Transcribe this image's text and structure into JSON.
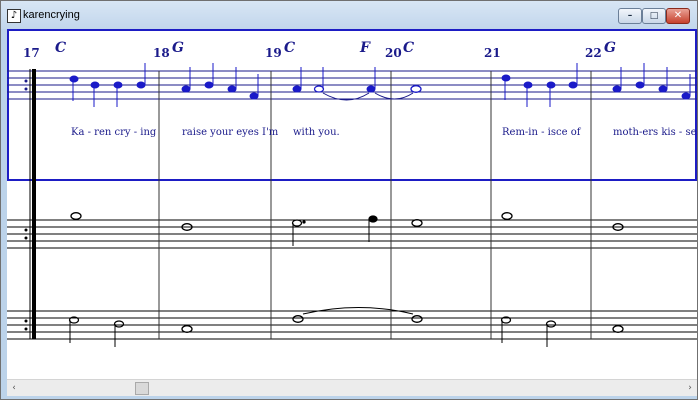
{
  "window": {
    "title": "karencrying",
    "app_icon": "music-note-icon",
    "buttons": [
      "minimize",
      "maximize",
      "close"
    ]
  },
  "controls": {
    "min_glyph": "–",
    "max_glyph": "□",
    "close_glyph": "✕"
  },
  "scrollbar": {
    "left_glyph": "‹",
    "right_glyph": "›"
  },
  "colors": {
    "accent": "#1a1aaa",
    "melody": "#1a1a8a",
    "staff": "#000000",
    "frame": "#1d1dc4"
  },
  "score": {
    "measures": [
      {
        "number": "17",
        "chord": "C",
        "lyric": "Ka - ren   cry - ing"
      },
      {
        "number": "18",
        "chord": "G",
        "lyric": "raise your eyes I'm"
      },
      {
        "number": "19",
        "chord": "C",
        "chord2": "F",
        "lyric": "with you."
      },
      {
        "number": "20",
        "chord": "C",
        "lyric": ""
      },
      {
        "number": "21",
        "chord": "",
        "lyric": "Rem-in - isce   of"
      },
      {
        "number": "22",
        "chord": "G",
        "lyric": "moth-ers   kis - se"
      }
    ]
  }
}
